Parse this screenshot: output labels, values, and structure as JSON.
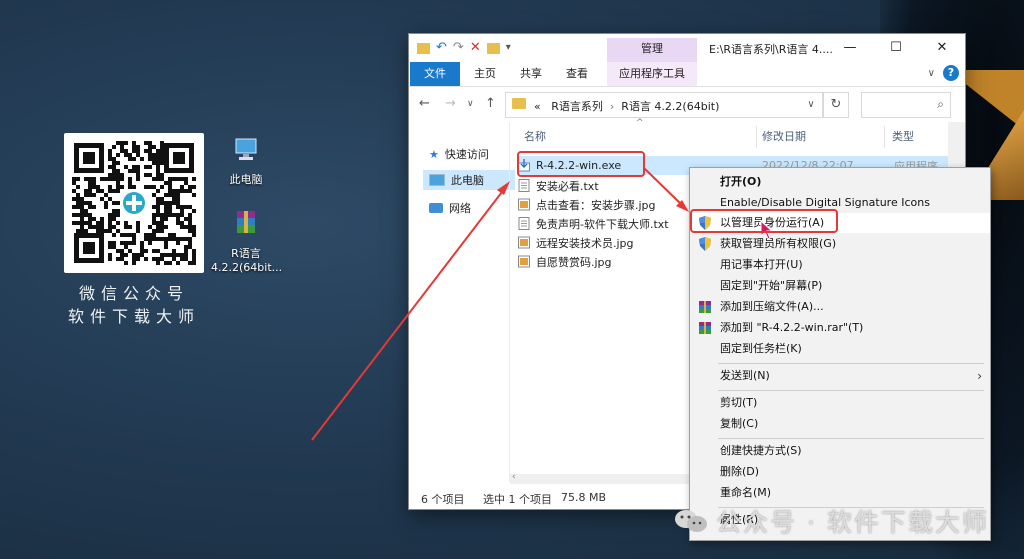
{
  "desktop": {
    "qr_caption_line1": "微信公众号",
    "qr_caption_line2": "软件下载大师",
    "icons": [
      {
        "label": "此电脑"
      },
      {
        "label_line1": "R语言",
        "label_line2": "4.2.2(64bit..."
      }
    ]
  },
  "window": {
    "title": "E:\\R语言系列\\R语言 4....",
    "manage_tab": "管理",
    "app_tools_tab": "应用程序工具",
    "ribbon_tabs": [
      "文件",
      "主页",
      "共享",
      "查看"
    ],
    "address": {
      "prefix": "«",
      "crumbs": [
        "R语言系列",
        "R语言 4.2.2(64bit)"
      ]
    },
    "nav_items": [
      "快速访问",
      "此电脑",
      "网络"
    ],
    "columns": [
      "名称",
      "修改日期",
      "类型"
    ],
    "files": [
      {
        "name": "R-4.2.2-win.exe",
        "date": "2022/12/8 22:07",
        "type": "应用程序",
        "icon": "installer-icon"
      },
      {
        "name": "安装必看.txt",
        "icon": "text-file-icon"
      },
      {
        "name": "点击查看：安装步骤.jpg",
        "icon": "image-file-icon"
      },
      {
        "name": "免责声明-软件下载大师.txt",
        "icon": "text-file-icon"
      },
      {
        "name": "远程安装技术员.jpg",
        "icon": "image-file-icon"
      },
      {
        "name": "自愿赞赏码.jpg",
        "icon": "image-file-icon"
      }
    ],
    "status": {
      "count": "6 个项目",
      "selected": "选中 1 个项目",
      "size": "75.8 MB"
    }
  },
  "context_menu": {
    "items": [
      {
        "label": "打开(O)",
        "bold": true
      },
      {
        "label": "Enable/Disable Digital Signature Icons"
      },
      {
        "label": "以管理员身份运行(A)",
        "icon": "uac-shield-icon",
        "highlight": true
      },
      {
        "label": "获取管理员所有权限(G)",
        "icon": "uac-shield-icon"
      },
      {
        "label": "用记事本打开(U)"
      },
      {
        "label": "固定到\"开始\"屏幕(P)"
      },
      {
        "label": "添加到压缩文件(A)...",
        "icon": "winrar-icon"
      },
      {
        "label": "添加到 \"R-4.2.2-win.rar\"(T)",
        "icon": "winrar-icon"
      },
      {
        "label": "固定到任务栏(K)"
      },
      {
        "label": "发送到(N)",
        "submenu": true
      },
      {
        "label": "剪切(T)"
      },
      {
        "label": "复制(C)"
      },
      {
        "label": "创建快捷方式(S)"
      },
      {
        "label": "删除(D)"
      },
      {
        "label": "重命名(M)"
      },
      {
        "label": "属性(R)"
      }
    ]
  },
  "watermark": "公众号 · 软件下载大师",
  "colors": {
    "accent": "#1979ca",
    "annotation_red": "#e53935",
    "selection": "#cce8ff",
    "manage_tab_bg": "#e9d8f4"
  }
}
